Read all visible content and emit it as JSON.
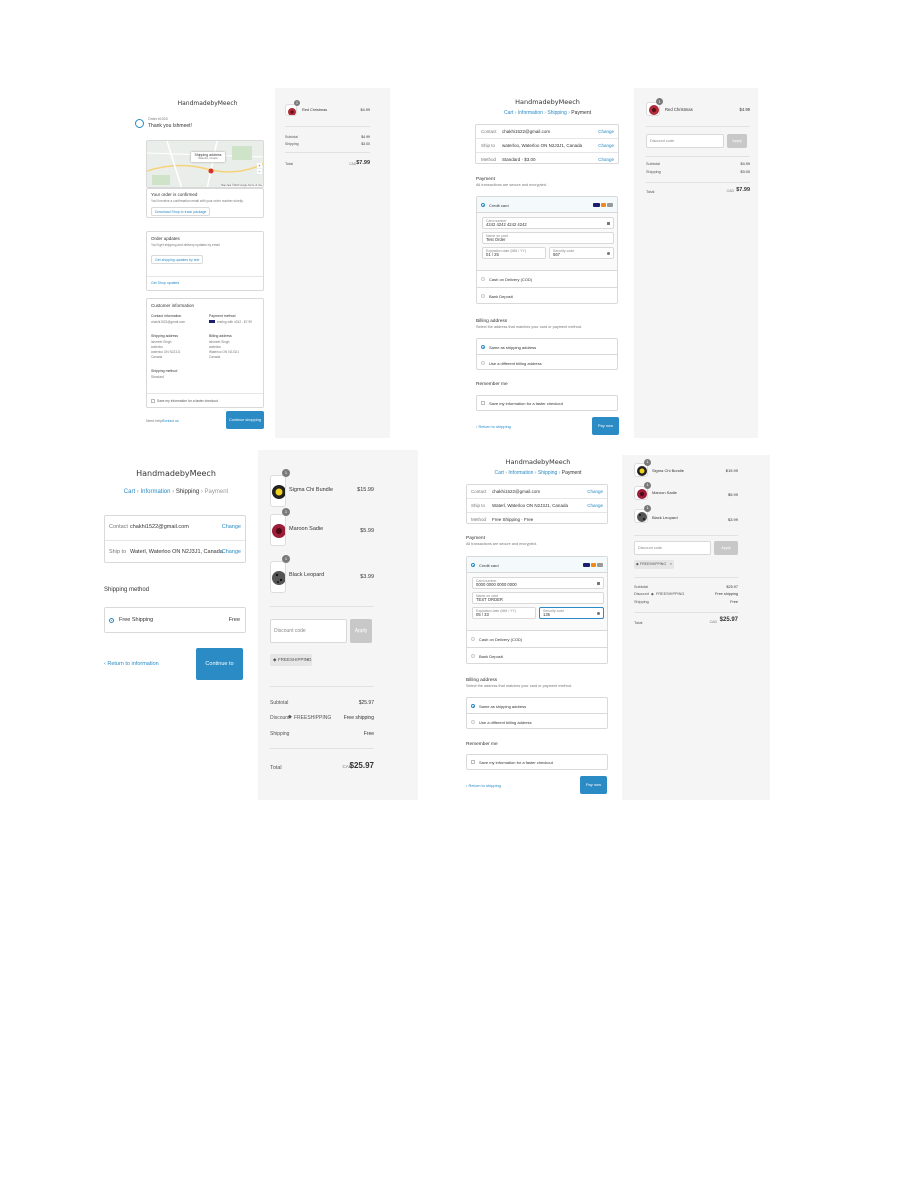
{
  "shop_name": "HandmadebyMeech",
  "panel1": {
    "order_number": "Order #1003",
    "thank_you": "Thank you Ishmeet!",
    "map_label": "Shipping address",
    "map_sub": "Waterloo, Ontario",
    "map_footer": "Map data ©2023 Google  Terms of Use",
    "confirmed_title": "Your order is confirmed",
    "confirmed_text": "You'll receive a confirmation email with your order number shortly.",
    "download_btn": "Download Shop to track package",
    "updates_title": "Order updates",
    "updates_text": "You'll get shipping and delivery updates by email.",
    "sms_btn": "Get shipping updates by text",
    "shop_updates": "Get Shop updates",
    "customer_info": "Customer information",
    "contact_info": "Contact information",
    "email": "chakhi1522@gmail.com",
    "payment_method": "Payment method",
    "payment_value": "ending with 4242 - $7.99",
    "shipping_address": "Shipping address",
    "shipping_lines": [
      "Ishmeet Singh",
      "waterloo",
      "waterloo ON N2J3J1",
      "Canada"
    ],
    "billing_address": "Billing address",
    "billing_lines": [
      "Ishmeet Singh",
      "waterloo",
      "Waterloo ON N2J3J1",
      "Canada"
    ],
    "shipping_method": "Shipping method",
    "shipping_method_value": "Standard",
    "save_info": "Save my information for a faster checkout",
    "need_help": "Need help?",
    "contact_us": "Contact us",
    "continue_btn": "Continue shopping"
  },
  "side1": {
    "items": [
      {
        "qty": "1",
        "name": "Red Christmas",
        "price": "$4.99"
      }
    ],
    "subtotal_label": "Subtotal",
    "subtotal": "$4.99",
    "shipping_label": "Shipping",
    "shipping": "$3.00",
    "total_label": "Total",
    "currency": "CAD",
    "total": "$7.99"
  },
  "panel2": {
    "breadcrumb": [
      "Cart",
      "Information",
      "Shipping",
      "Payment"
    ],
    "review_rows": [
      {
        "label": "Contact",
        "value": "chakhi1522@gmail.com",
        "change": "Change"
      },
      {
        "label": "Ship to",
        "value": "waterloo, Waterloo ON N2J3J1, Canada",
        "change": "Change"
      },
      {
        "label": "Method",
        "value": "Standard · $3.00",
        "change": "Change"
      }
    ],
    "payment_title": "Payment",
    "payment_sub": "All transactions are secure and encrypted.",
    "credit_card": "Credit card",
    "card_number_label": "Card number",
    "card_number": "4242 4242 4242 4242",
    "name_label": "Name on card",
    "name": "Test Order",
    "exp_label": "Expiration date (MM / YY)",
    "exp": "01 / 25",
    "cvv_label": "Security code",
    "cvv": "567",
    "cod": "Cash on Delivery (COD)",
    "bank": "Bank Deposit",
    "billing_title": "Billing address",
    "billing_sub": "Select the address that matches your card or payment method.",
    "same_address": "Same as shipping address",
    "diff_address": "Use a different billing address",
    "remember_title": "Remember me",
    "remember_check": "Save my information for a faster checkout",
    "return_link": "‹ Return to shipping",
    "pay_btn": "Pay now"
  },
  "side2": {
    "items": [
      {
        "qty": "1",
        "name": "Red Christmas",
        "price": "$4.99"
      }
    ],
    "discount_placeholder": "Discount code",
    "apply": "Apply",
    "subtotal_label": "Subtotal",
    "subtotal": "$4.99",
    "shipping_label": "Shipping",
    "shipping": "$3.00",
    "total_label": "Total",
    "currency": "CAD",
    "total": "$7.99"
  },
  "panel3": {
    "breadcrumb": [
      "Cart",
      "Information",
      "Shipping",
      "Payment"
    ],
    "review_rows": [
      {
        "label": "Contact",
        "value": "chakhi1522@gmail.com",
        "change": "Change"
      },
      {
        "label": "Ship to",
        "value": "Waterl, Waterloo ON N2J3J1, Canada",
        "change": "Change"
      }
    ],
    "method_title": "Shipping method",
    "method_name": "Free Shipping",
    "method_price": "Free",
    "return_link": "‹ Return to information",
    "continue_btn": "Continue to payment"
  },
  "side3": {
    "items": [
      {
        "qty": "1",
        "name": "Sigma Chi Bundle",
        "price": "$15.99"
      },
      {
        "qty": "1",
        "name": "Maroon Sadie",
        "price": "$5.99"
      },
      {
        "qty": "1",
        "name": "Black Leopard",
        "price": "$3.99"
      }
    ],
    "discount_placeholder": "Discount code",
    "apply": "Apply",
    "tag": "FREESHIPPING",
    "subtotal_label": "Subtotal",
    "subtotal": "$25.97",
    "discount_label": "Discount",
    "discount_code": "FREESHIPPING",
    "discount_value": "Free shipping",
    "shipping_label": "Shipping",
    "shipping": "Free",
    "total_label": "Total",
    "currency": "CAD",
    "total": "$25.97"
  },
  "panel4": {
    "breadcrumb": [
      "Cart",
      "Information",
      "Shipping",
      "Payment"
    ],
    "review_rows": [
      {
        "label": "Contact",
        "value": "chakhi1522@gmail.com",
        "change": "Change"
      },
      {
        "label": "Ship to",
        "value": "Waterl, Waterloo ON N2J3J1, Canada",
        "change": "Change"
      },
      {
        "label": "Method",
        "value": "Free Shipping · Free",
        "change": ""
      }
    ],
    "payment_title": "Payment",
    "payment_sub": "All transactions are secure and encrypted.",
    "credit_card": "Credit card",
    "card_number_label": "Card number",
    "card_number": "0000 0000 0000 0000",
    "name_label": "Name on card",
    "name": "TEST ORDER",
    "exp_label": "Expiration date (MM / YY)",
    "exp": "05 / 33",
    "cvv_label": "Security code",
    "cvv": "135",
    "cod": "Cash on Delivery (COD)",
    "bank": "Bank Deposit",
    "billing_title": "Billing address",
    "billing_sub": "Select the address that matches your card or payment method.",
    "same_address": "Same as shipping address",
    "diff_address": "Use a different billing address",
    "remember_title": "Remember me",
    "remember_check": "Save my information for a faster checkout",
    "return_link": "‹ Return to shipping",
    "pay_btn": "Pay now"
  },
  "side4": {
    "items": [
      {
        "qty": "1",
        "name": "Sigma Chi Bundle",
        "price": "$15.99"
      },
      {
        "qty": "1",
        "name": "Maroon Sadie",
        "price": "$5.99"
      },
      {
        "qty": "1",
        "name": "Black Leopard",
        "price": "$3.99"
      }
    ],
    "discount_placeholder": "Discount code",
    "apply": "Apply",
    "tag": "FREESHIPPING",
    "subtotal_label": "Subtotal",
    "subtotal": "$25.97",
    "discount_label": "Discount",
    "discount_code": "FREESHIPPING",
    "discount_value": "Free shipping",
    "shipping_label": "Shipping",
    "shipping": "Free",
    "total_label": "Total",
    "currency": "CAD",
    "total": "$25.97"
  },
  "colors": {
    "accent": "#2a8bc5",
    "sidebar_bg": "#f5f5f5",
    "border": "#d9d9d9"
  },
  "icons": [
    "check-circle-icon",
    "lock-icon",
    "help-icon",
    "tag-icon",
    "map-pin-icon"
  ]
}
